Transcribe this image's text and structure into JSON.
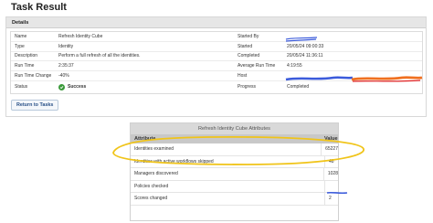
{
  "page": {
    "title": "Task Result"
  },
  "details": {
    "header": "Details",
    "rows": [
      {
        "label": "Name",
        "value": "Refresh Identity Cube",
        "label2": "Started By",
        "value2": ""
      },
      {
        "label": "Type",
        "value": "Identity",
        "label2": "Started",
        "value2": "20/05/24 09:00:33"
      },
      {
        "label": "Description",
        "value": "Perform a full refresh of all the identities.",
        "label2": "Completed",
        "value2": "20/05/24 11:36:11"
      },
      {
        "label": "Run Time",
        "value": "2:35:37",
        "label2": "Average Run Time",
        "value2": "4:19:55"
      },
      {
        "label": "Run Time Change",
        "value": "-40%",
        "label2": "Host",
        "value2": ""
      }
    ],
    "status_row": {
      "label": "Status",
      "value": "Success",
      "label2": "Progress",
      "value2": "Completed",
      "icon": "check-circle-icon",
      "icon_color": "#3a9a3a"
    }
  },
  "buttons": {
    "return_label": "Return to Tasks"
  },
  "attributes": {
    "title": "Refresh Identity Cube Attributes",
    "col_attribute": "Attribute",
    "col_value": "Value",
    "rows": [
      {
        "name": "Identities examined",
        "value": "65227"
      },
      {
        "name": "Identities with active workflows skipped",
        "value": "48"
      },
      {
        "name": "Managers discovered",
        "value": "1028"
      },
      {
        "name": "Policies checked",
        "value": ""
      },
      {
        "name": "Scores changed",
        "value": "2"
      }
    ]
  },
  "annotations": {
    "highlight_color": "#f0c419",
    "redact_blue": "#3b5bdb",
    "redact_orange": "#f07020",
    "redact_red": "#e02020"
  }
}
